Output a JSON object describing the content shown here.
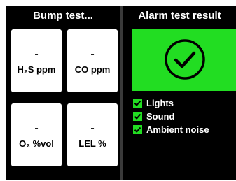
{
  "bump_panel": {
    "title": "Bump test...",
    "tiles": [
      {
        "value": "-",
        "unit": "H₂S ppm"
      },
      {
        "value": "-",
        "unit": "CO ppm"
      },
      {
        "value": "-",
        "unit": "O₂ %vol"
      },
      {
        "value": "-",
        "unit": "LEL %"
      }
    ]
  },
  "alarm_panel": {
    "title": "Alarm test result",
    "result_icon": "check-circle-icon",
    "checks": [
      {
        "label": "Lights",
        "checked": true
      },
      {
        "label": "Sound",
        "checked": true
      },
      {
        "label": "Ambient noise",
        "checked": true
      }
    ]
  },
  "colors": {
    "pass_green": "#22dd22",
    "panel_bg": "#000000",
    "tile_bg": "#ffffff",
    "text": "#ffffff"
  }
}
